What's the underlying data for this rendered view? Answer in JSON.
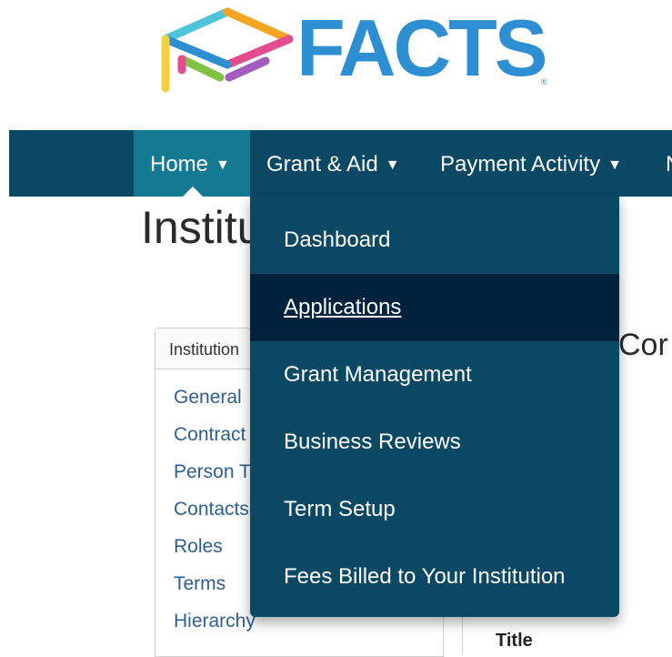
{
  "brand": {
    "name": "FACTS",
    "registered_mark": "®",
    "colors": {
      "wordmark": "#2d8fd2",
      "navbar": "#0b4864",
      "nav_active": "#137a92",
      "menu_active": "#00223d"
    }
  },
  "navbar": {
    "items": [
      {
        "label": "Home",
        "icon": "caret-down-icon",
        "active": true
      },
      {
        "label": "Grant & Aid",
        "icon": "caret-down-icon",
        "active": false
      },
      {
        "label": "Payment Activity",
        "icon": "caret-down-icon",
        "active": false
      },
      {
        "label": "N",
        "active": false
      }
    ]
  },
  "page": {
    "title": "Institu"
  },
  "panel": {
    "header": "Institution",
    "links": [
      "General",
      "Contract",
      "Person T",
      "Contacts",
      "Roles",
      "Terms",
      "Hierarchy"
    ]
  },
  "main": {
    "heading": "Cor",
    "column_label": "Title"
  },
  "dropdown": {
    "items": [
      {
        "label": "Dashboard",
        "active": false
      },
      {
        "label": "Applications",
        "active": true
      },
      {
        "label": "Grant Management",
        "active": false
      },
      {
        "label": "Business Reviews",
        "active": false
      },
      {
        "label": "Term Setup",
        "active": false
      },
      {
        "label": "Fees Billed to Your Institution",
        "active": false
      }
    ]
  }
}
